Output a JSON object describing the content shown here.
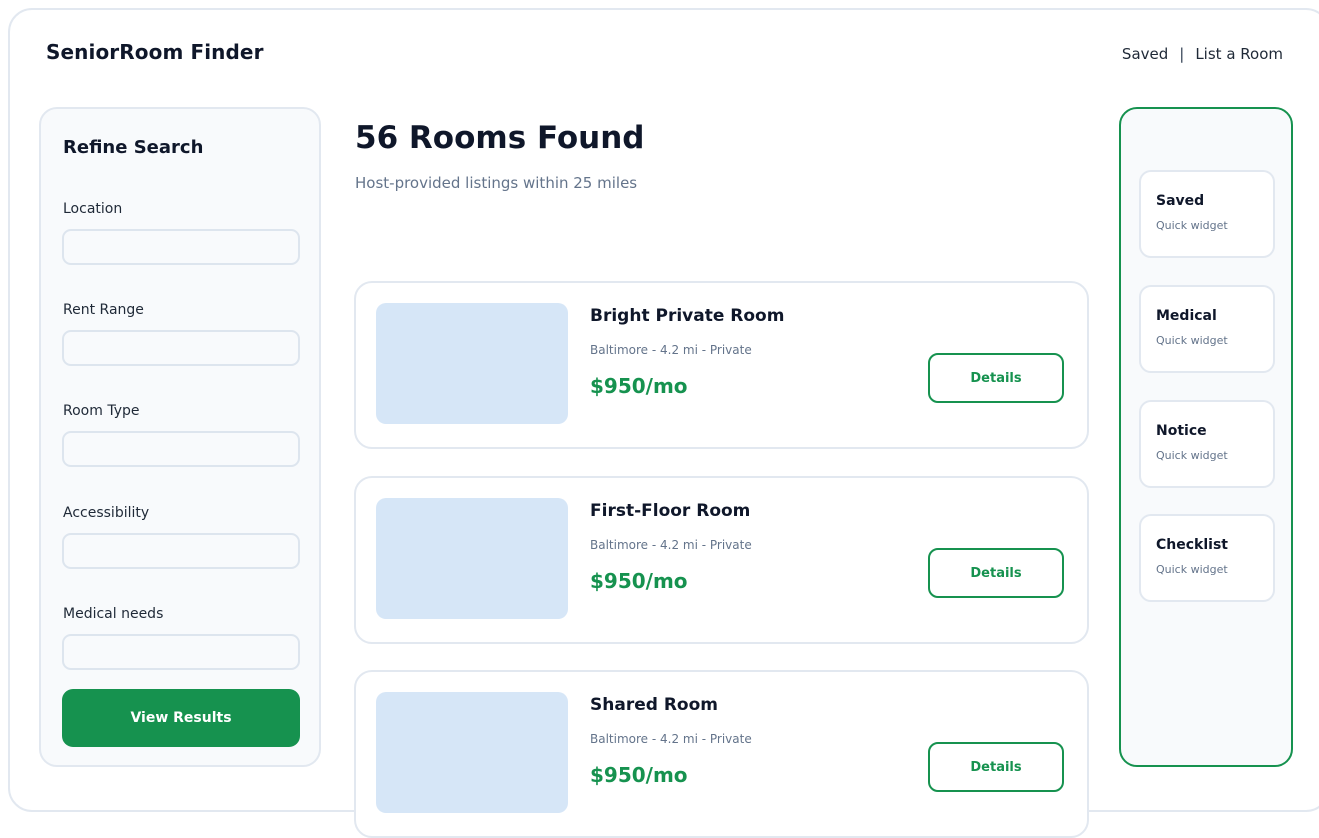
{
  "app": {
    "brand": "SeniorRoom Finder"
  },
  "topnav": {
    "saved": "Saved",
    "separator": "|",
    "list_room": "List a Room"
  },
  "filters": {
    "title": "Refine Search",
    "fields": [
      {
        "label": "Location",
        "value": ""
      },
      {
        "label": "Rent Range",
        "value": ""
      },
      {
        "label": "Room Type",
        "value": ""
      },
      {
        "label": "Accessibility",
        "value": ""
      },
      {
        "label": "Medical needs",
        "value": ""
      }
    ],
    "submit_label": "View Results"
  },
  "results": {
    "title": "56 Rooms Found",
    "subtitle": "Host-provided listings within 25 miles",
    "listings": [
      {
        "name": "Bright Private Room",
        "meta": "Baltimore - 4.2 mi - Private",
        "price": "$950/mo",
        "action": "Details"
      },
      {
        "name": "First-Floor Room",
        "meta": "Baltimore - 4.2 mi - Private",
        "price": "$950/mo",
        "action": "Details"
      },
      {
        "name": "Shared Room",
        "meta": "Baltimore - 4.2 mi - Private",
        "price": "$950/mo",
        "action": "Details"
      }
    ]
  },
  "widgets": [
    {
      "title": "Saved",
      "subtitle": "Quick widget"
    },
    {
      "title": "Medical",
      "subtitle": "Quick widget"
    },
    {
      "title": "Notice",
      "subtitle": "Quick widget"
    },
    {
      "title": "Checklist",
      "subtitle": "Quick widget"
    }
  ],
  "colors": {
    "accent": "#16924f",
    "thumb": "#d6e6f7",
    "border": "#e2e8f0"
  }
}
